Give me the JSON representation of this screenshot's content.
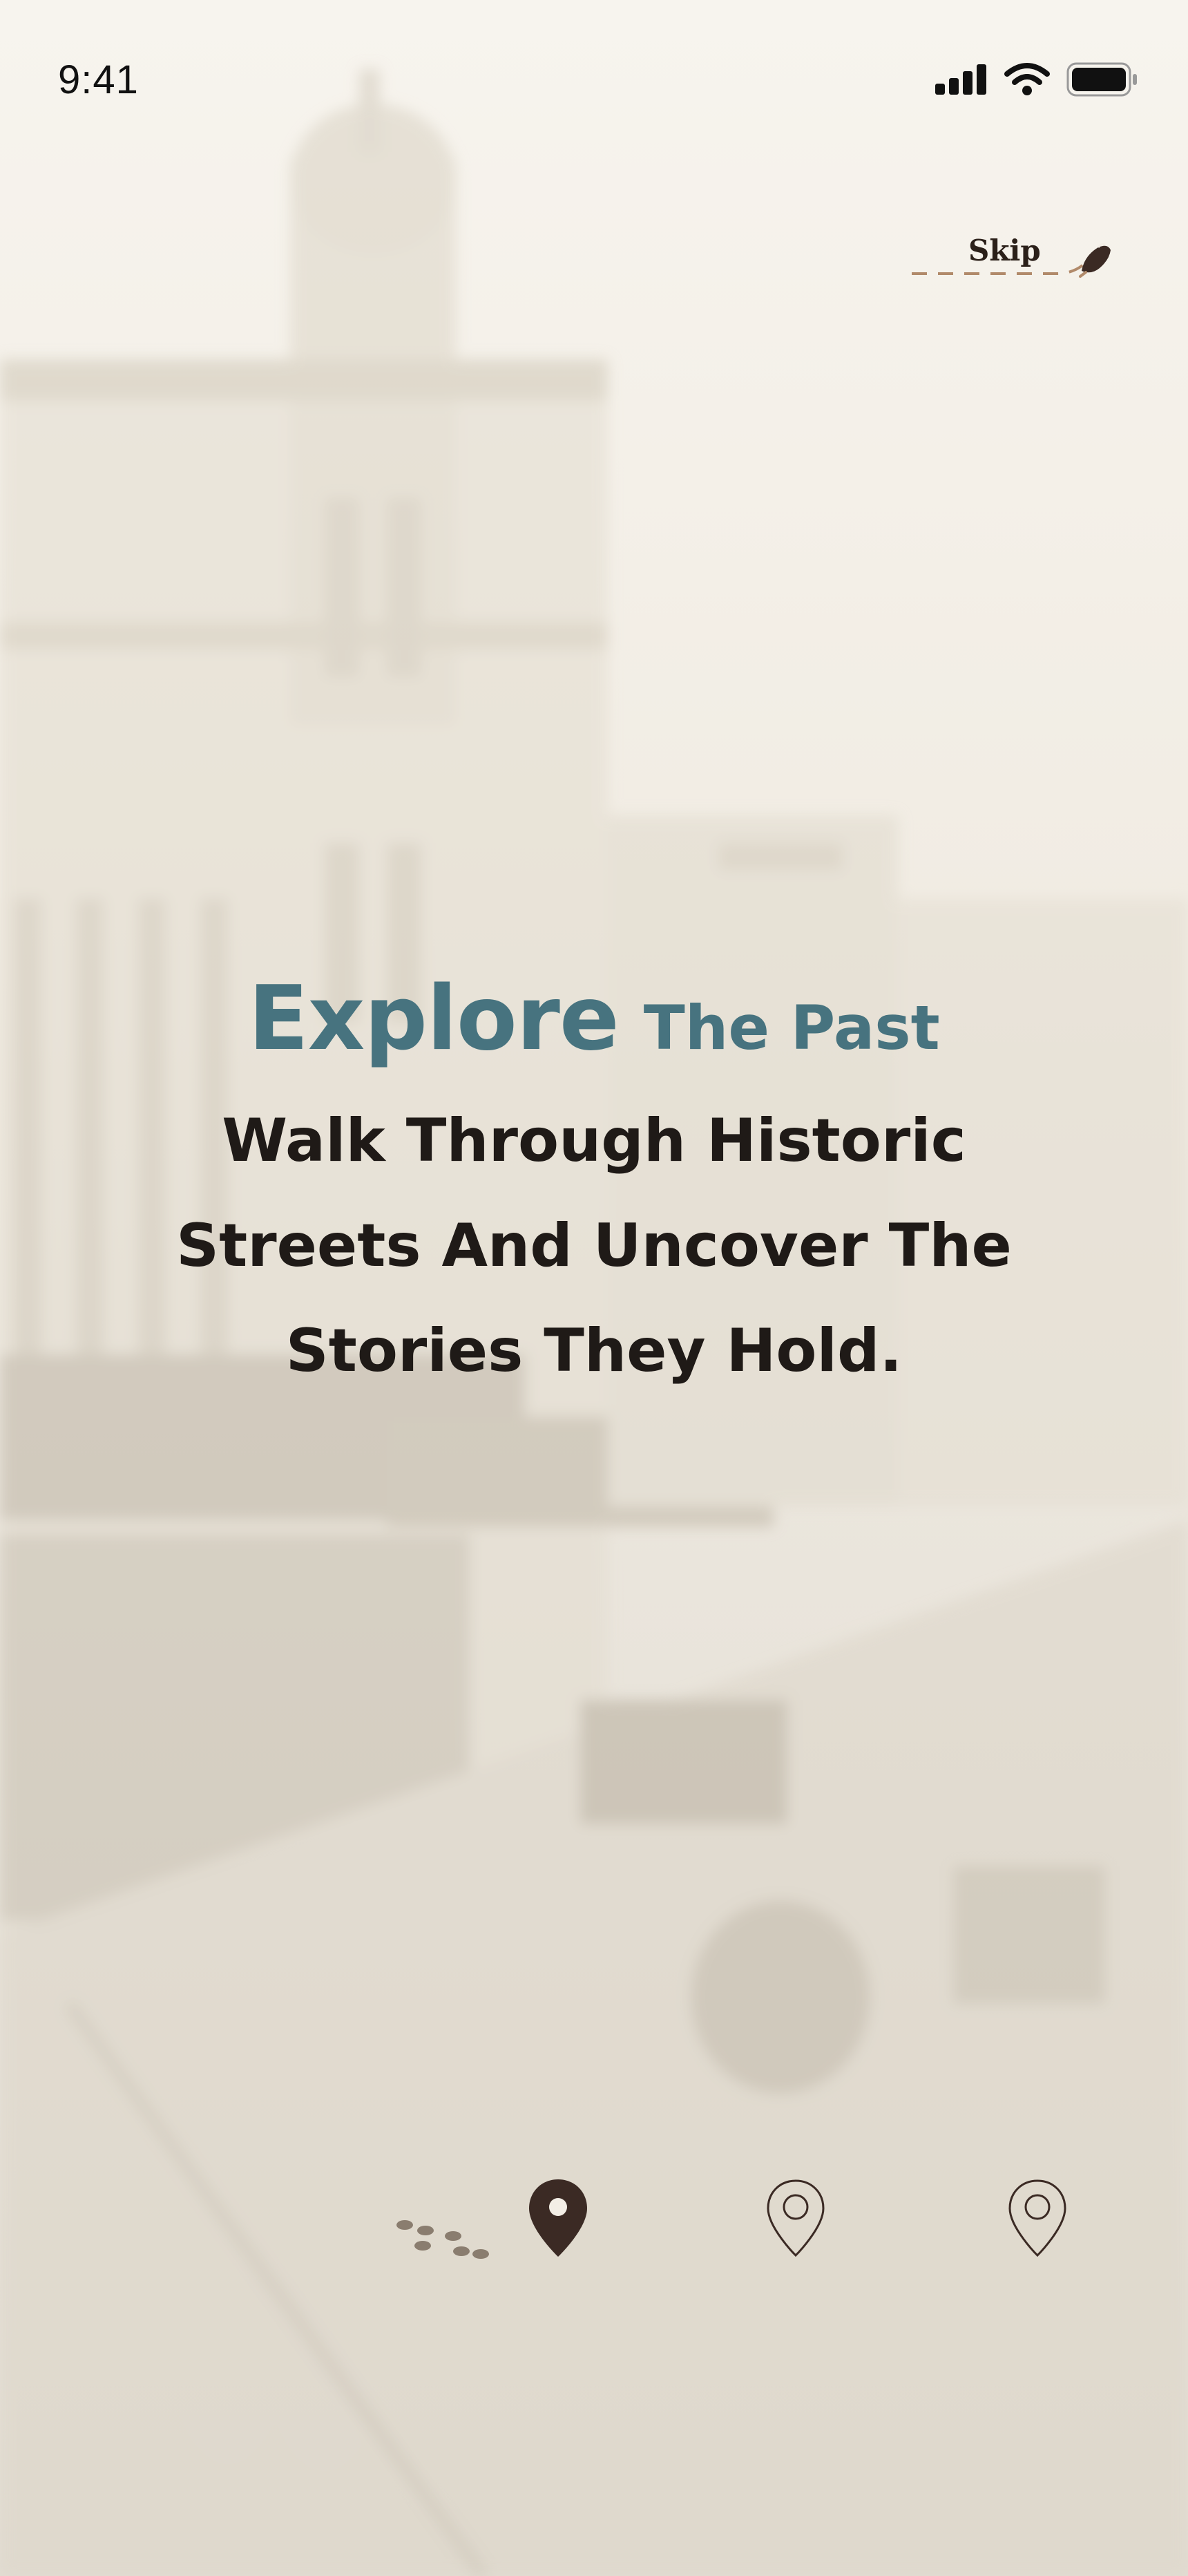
{
  "status_bar": {
    "time": "9:41",
    "icons": [
      "signal-icon",
      "wifi-icon",
      "battery-icon"
    ]
  },
  "skip": {
    "label": "Skip",
    "icon": "pointing-hand-icon"
  },
  "hero": {
    "title_emphasis": "Explore",
    "title_rest": "The Past",
    "lines": [
      "Walk Through Historic",
      "Streets And Uncover The",
      "Stories They Hold."
    ]
  },
  "progress": {
    "icons": [
      "footsteps-icon",
      "location-pin-icon",
      "location-pin-outline-icon",
      "location-pin-outline-icon"
    ],
    "steps_total": 3,
    "current_step": 1
  },
  "colors": {
    "accent": "#47737f",
    "text_dark": "#1f1a17",
    "pin_active": "#3b2a24",
    "pin_inactive": "#3b2a24",
    "trail": "#b18a6a"
  }
}
